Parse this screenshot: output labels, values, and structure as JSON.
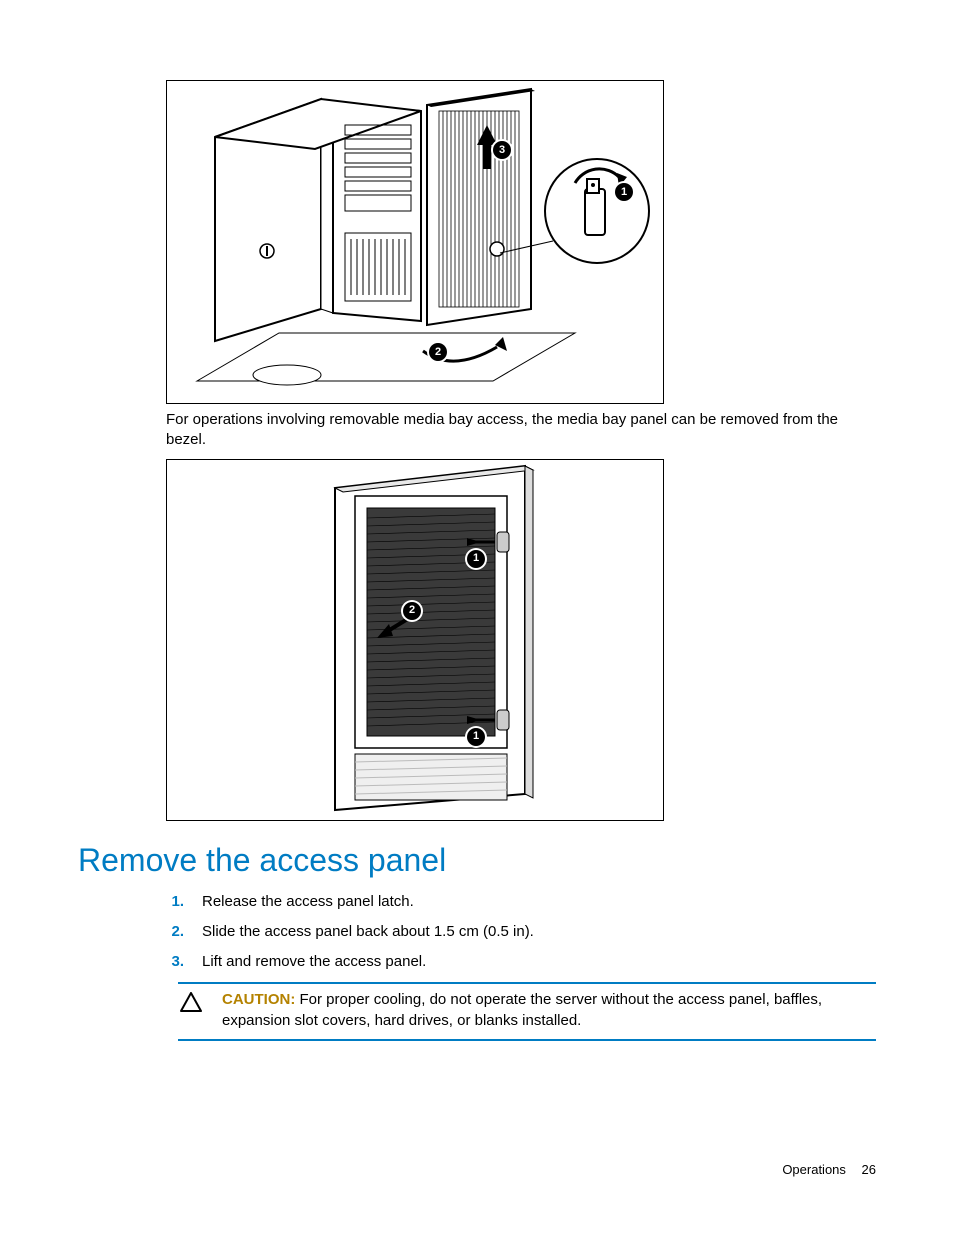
{
  "paragraph1": "For operations involving removable media bay access, the media bay panel can be removed from the bezel.",
  "section_heading": "Remove the access panel",
  "steps": [
    "Release the access panel latch.",
    "Slide the access panel back about 1.5 cm (0.5 in).",
    "Lift and remove the access panel."
  ],
  "caution": {
    "label": "CAUTION:",
    "text": "For proper cooling, do not operate the server without the access panel, baffles, expansion slot covers, hard drives, or blanks installed."
  },
  "footer": {
    "section": "Operations",
    "page": "26"
  },
  "fig1_callouts": [
    "1",
    "2",
    "3"
  ],
  "fig2_callouts": [
    "1",
    "2",
    "1"
  ]
}
